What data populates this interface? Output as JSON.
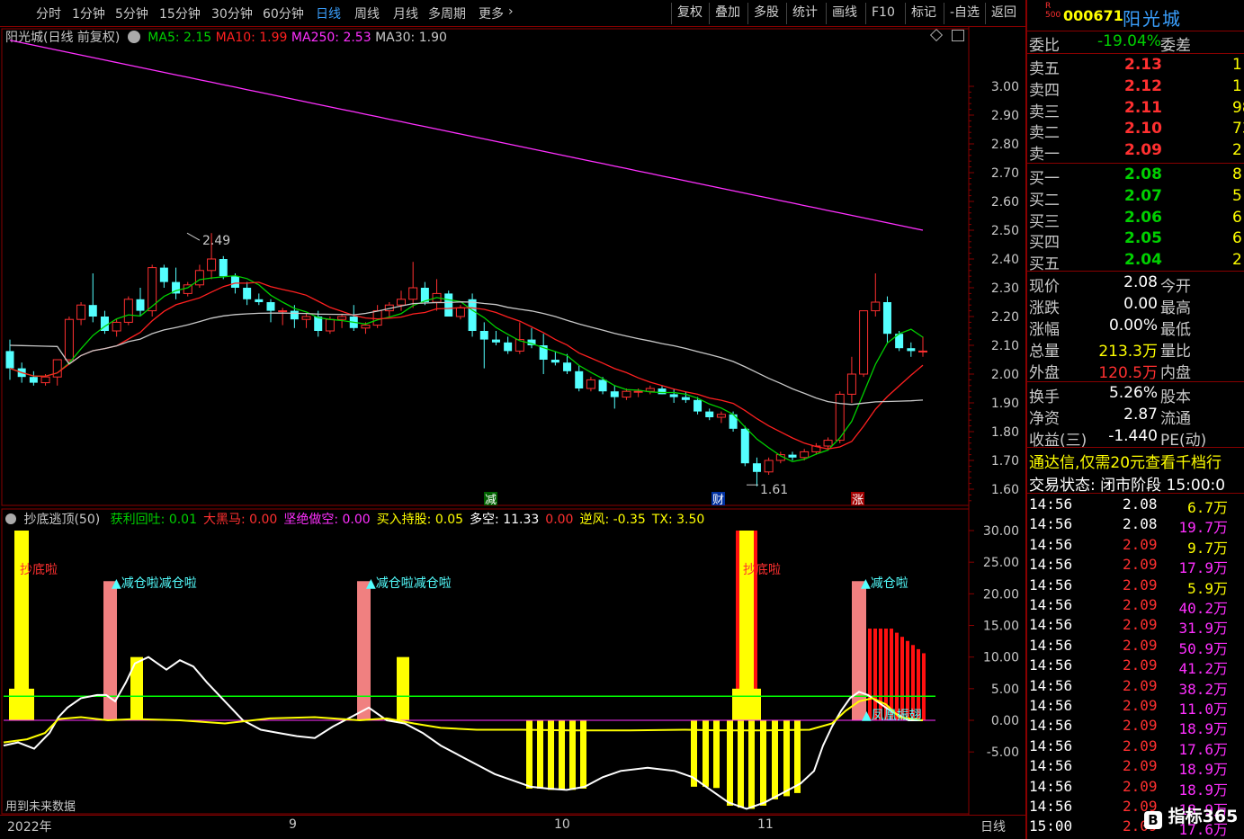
{
  "toolbar": {
    "timeframes": [
      "分时",
      "1分钟",
      "5分钟",
      "15分钟",
      "30分钟",
      "60分钟",
      "日线",
      "周线",
      "月线",
      "多周期",
      "更多"
    ],
    "active_timeframe": "日线",
    "buttons": [
      "复权",
      "叠加",
      "多股",
      "统计",
      "画线",
      "F10",
      "标记",
      "-自选",
      "返回"
    ]
  },
  "main_legend": {
    "title": "阳光城(日线 前复权)",
    "ma5": "MA5: 2.15",
    "ma10": "MA10: 1.99",
    "ma250": "MA250: 2.53",
    "ma30": "MA30: 1.90"
  },
  "indicator_legend": {
    "name": "抄底逃顶(50)",
    "items": [
      {
        "text": "获利回吐: 0.01",
        "color": "#00d000"
      },
      {
        "text": "大黑马: 0.00",
        "color": "#ff3030"
      },
      {
        "text": "坚绝做空: 0.00",
        "color": "#ff30ff"
      },
      {
        "text": "买入持股: 0.05",
        "color": "#ffff00"
      },
      {
        "text": "多空: 11.33",
        "color": "#ffffff"
      },
      {
        "text": "0.00",
        "color": "#ff3030"
      },
      {
        "text": "逆风: -0.35",
        "color": "#ffff00"
      },
      {
        "text": "TX: 3.50",
        "color": "#ffff00"
      }
    ]
  },
  "price_axis": [
    "3.00",
    "2.90",
    "2.80",
    "2.70",
    "2.60",
    "2.50",
    "2.40",
    "2.30",
    "2.20",
    "2.10",
    "2.00",
    "1.90",
    "1.80",
    "1.70",
    "1.60"
  ],
  "indicator_axis": [
    "30.00",
    "25.00",
    "20.00",
    "15.00",
    "10.00",
    "5.00",
    "0.00",
    "-5.00"
  ],
  "annotations": {
    "high": "2.49",
    "low": "1.61",
    "chaodi1": "抄底啦",
    "chaodi2": "抄底啦",
    "jiancang1": "▲减仓啦减仓啦",
    "jiancang2": "▲减仓啦减仓啦",
    "jiancang3": "▲减仓啦",
    "fenghuang": "▲凤凰振翅",
    "future": "用到未来数据",
    "tag_jian": "减",
    "tag_cai": "财",
    "tag_zhang": "涨"
  },
  "date_axis": {
    "year": "2022年",
    "m9": "9",
    "m10": "10",
    "m11": "11",
    "period": "日线"
  },
  "stock": {
    "badge": "R 500",
    "code": "000671",
    "name": "阳光城"
  },
  "weibi": {
    "label": "委比",
    "value": "-19.04%",
    "label2": "委差"
  },
  "asks": [
    {
      "label": "卖五",
      "price": "2.13",
      "vol": "1"
    },
    {
      "label": "卖四",
      "price": "2.12",
      "vol": "1"
    },
    {
      "label": "卖三",
      "price": "2.11",
      "vol": "98"
    },
    {
      "label": "卖二",
      "price": "2.10",
      "vol": "73"
    },
    {
      "label": "卖一",
      "price": "2.09",
      "vol": "2"
    }
  ],
  "bids": [
    {
      "label": "买一",
      "price": "2.08",
      "vol": "8"
    },
    {
      "label": "买二",
      "price": "2.07",
      "vol": "5"
    },
    {
      "label": "买三",
      "price": "2.06",
      "vol": "6"
    },
    {
      "label": "买四",
      "price": "2.05",
      "vol": "6"
    },
    {
      "label": "买五",
      "price": "2.04",
      "vol": "2"
    }
  ],
  "quote": [
    {
      "l1": "现价",
      "v1": "2.08",
      "c1": "#ffffff",
      "l2": "今开"
    },
    {
      "l1": "涨跌",
      "v1": "0.00",
      "c1": "#ffffff",
      "l2": "最高"
    },
    {
      "l1": "涨幅",
      "v1": "0.00%",
      "c1": "#ffffff",
      "l2": "最低"
    },
    {
      "l1": "总量",
      "v1": "213.3万",
      "c1": "#ffff00",
      "l2": "量比"
    },
    {
      "l1": "外盘",
      "v1": "120.5万",
      "c1": "#ff3030",
      "l2": "内盘"
    }
  ],
  "fund": [
    {
      "l1": "换手",
      "v1": "5.26%",
      "l2": "股本"
    },
    {
      "l1": "净资",
      "v1": "2.87",
      "l2": "流通"
    },
    {
      "l1": "收益(三)",
      "v1": "-1.440",
      "l2": "PE(动)"
    }
  ],
  "ad": "通达信,仅需20元查看千档行",
  "trade_state": "交易状态: 闭市阶段 15:00:0",
  "ticks": [
    {
      "t": "14:56",
      "p": "2.08",
      "pc": "#ffffff",
      "v": "6.7万",
      "vc": "#ffff00"
    },
    {
      "t": "14:56",
      "p": "2.08",
      "pc": "#ffffff",
      "v": "19.7万",
      "vc": "#ff30ff"
    },
    {
      "t": "14:56",
      "p": "2.09",
      "pc": "#ff3030",
      "v": "9.7万",
      "vc": "#ffff00"
    },
    {
      "t": "14:56",
      "p": "2.09",
      "pc": "#ff3030",
      "v": "17.9万",
      "vc": "#ff30ff"
    },
    {
      "t": "14:56",
      "p": "2.09",
      "pc": "#ff3030",
      "v": "5.9万",
      "vc": "#ffff00"
    },
    {
      "t": "14:56",
      "p": "2.09",
      "pc": "#ff3030",
      "v": "40.2万",
      "vc": "#ff30ff"
    },
    {
      "t": "14:56",
      "p": "2.09",
      "pc": "#ff3030",
      "v": "31.9万",
      "vc": "#ff30ff"
    },
    {
      "t": "14:56",
      "p": "2.09",
      "pc": "#ff3030",
      "v": "50.9万",
      "vc": "#ff30ff"
    },
    {
      "t": "14:56",
      "p": "2.09",
      "pc": "#ff3030",
      "v": "41.2万",
      "vc": "#ff30ff"
    },
    {
      "t": "14:56",
      "p": "2.09",
      "pc": "#ff3030",
      "v": "38.2万",
      "vc": "#ff30ff"
    },
    {
      "t": "14:56",
      "p": "2.09",
      "pc": "#ff3030",
      "v": "11.0万",
      "vc": "#ff30ff"
    },
    {
      "t": "14:56",
      "p": "2.09",
      "pc": "#ff3030",
      "v": "18.9万",
      "vc": "#ff30ff"
    },
    {
      "t": "14:56",
      "p": "2.09",
      "pc": "#ff3030",
      "v": "17.6万",
      "vc": "#ff30ff"
    },
    {
      "t": "14:56",
      "p": "2.09",
      "pc": "#ff3030",
      "v": "18.9万",
      "vc": "#ff30ff"
    },
    {
      "t": "14:56",
      "p": "2.09",
      "pc": "#ff3030",
      "v": "18.9万",
      "vc": "#ff30ff"
    },
    {
      "t": "14:56",
      "p": "2.09",
      "pc": "#ff3030",
      "v": "18.9万",
      "vc": "#ff30ff"
    },
    {
      "t": "15:00",
      "p": "2.09",
      "pc": "#ff3030",
      "v": "17.6万",
      "vc": "#ff30ff"
    }
  ],
  "watermark": "指标365",
  "colors": {
    "up": "#ff3030",
    "down": "#54ffff",
    "ma5": "#00d000",
    "ma10": "#ff2020",
    "ma30": "#c8c8c8",
    "ma250": "#ff30ff",
    "frame": "#880000"
  }
}
